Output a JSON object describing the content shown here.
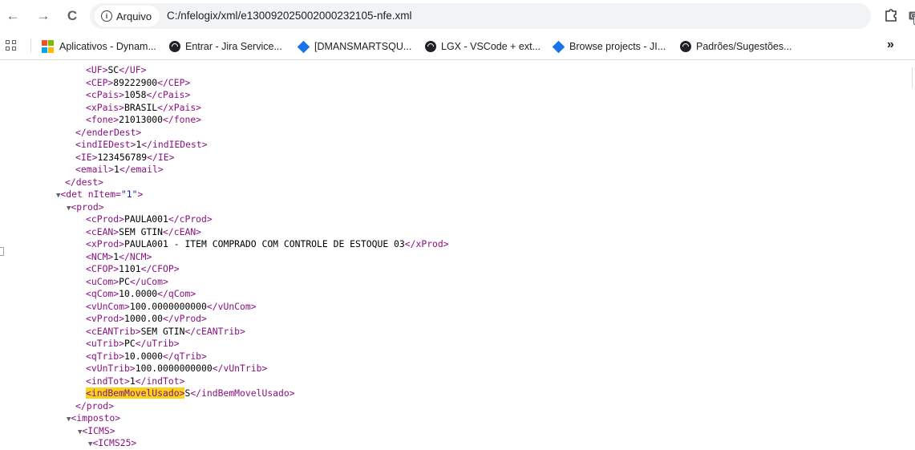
{
  "browser": {
    "nav": {
      "back": "←",
      "forward": "→",
      "reload": "C"
    },
    "site_chip": "Arquivo",
    "url": "C:/nfelogix/xml/e13009202500200023​2105-nfe.xml",
    "bookmarks": [
      {
        "label": "Aplicativos - Dynam..."
      },
      {
        "label": "Entrar - Jira Service..."
      },
      {
        "label": "[DMANSMARTSQU..."
      },
      {
        "label": "LGX - VSCode + ext..."
      },
      {
        "label": "Browse projects - JI..."
      },
      {
        "label": "Padrões/Sugestões..."
      }
    ],
    "more": "»",
    "colors": {
      "tag": "#881280",
      "attr_value": "#1a1aa6",
      "highlight": "#f8d31d",
      "ms_red": "#f25022",
      "ms_green": "#7fba00",
      "ms_blue": "#00a4ef",
      "ms_yellow": "#ffb900",
      "jira_blue": "#1a73e8"
    }
  },
  "xml": {
    "l01": {
      "open": "<UF>",
      "text": "SC",
      "close": "</UF>"
    },
    "l02": {
      "open": "<CEP>",
      "text": "89222900",
      "close": "</CEP>"
    },
    "l03": {
      "open": "<cPais>",
      "text": "1058",
      "close": "</cPais>"
    },
    "l04": {
      "open": "<xPais>",
      "text": "BRASIL",
      "close": "</xPais>"
    },
    "l05": {
      "open": "<fone>",
      "text": "21013000",
      "close": "</fone>"
    },
    "l06": {
      "close": "</enderDest>"
    },
    "l07": {
      "open": "<indIEDest>",
      "text": "1",
      "close": "</indIEDest>"
    },
    "l08": {
      "open": "<IE>",
      "text": "123456789",
      "close": "</IE>"
    },
    "l09": {
      "open": "<email>",
      "text": "1",
      "close": "</email>"
    },
    "l10": {
      "close": "</dest>"
    },
    "l11": {
      "tag_start": "<det",
      "attr_name": " nItem=",
      "attr_value": "\"1\"",
      "tag_end": ">"
    },
    "l12": {
      "open": "<prod>"
    },
    "l13": {
      "open": "<cProd>",
      "text": "PAULA001",
      "close": "</cProd>"
    },
    "l14": {
      "open": "<cEAN>",
      "text": "SEM GTIN",
      "close": "</cEAN>"
    },
    "l15": {
      "open": "<xProd>",
      "text": "PAULA001 - ITEM COMPRADO COM CONTROLE DE ESTOQUE 03",
      "close": "</xProd>"
    },
    "l16": {
      "open": "<NCM>",
      "text": "1",
      "close": "</NCM>"
    },
    "l17": {
      "open": "<CFOP>",
      "text": "1101",
      "close": "</CFOP>"
    },
    "l18": {
      "open": "<uCom>",
      "text": "PC",
      "close": "</uCom>"
    },
    "l19": {
      "open": "<qCom>",
      "text": "10.0000",
      "close": "</qCom>"
    },
    "l20": {
      "open": "<vUnCom>",
      "text": "100.0000000000",
      "close": "</vUnCom>"
    },
    "l21": {
      "open": "<vProd>",
      "text": "1000.00",
      "close": "</vProd>"
    },
    "l22": {
      "open": "<cEANTrib>",
      "text": "SEM GTIN",
      "close": "</cEANTrib>"
    },
    "l23": {
      "open": "<uTrib>",
      "text": "PC",
      "close": "</uTrib>"
    },
    "l24": {
      "open": "<qTrib>",
      "text": "10.0000",
      "close": "</qTrib>"
    },
    "l25": {
      "open": "<vUnTrib>",
      "text": "100.0000000000",
      "close": "</vUnTrib>"
    },
    "l26": {
      "open": "<indTot>",
      "text": "1",
      "close": "</indTot>"
    },
    "l27": {
      "open": "<indBemMovelUsado>",
      "text": "S",
      "close": "</indBemMovelUsado>"
    },
    "l28": {
      "close": "</prod>"
    },
    "l29": {
      "open": "<imposto>"
    },
    "l30": {
      "open": "<ICMS>"
    },
    "l31": {
      "open": "<ICMS25>"
    }
  }
}
